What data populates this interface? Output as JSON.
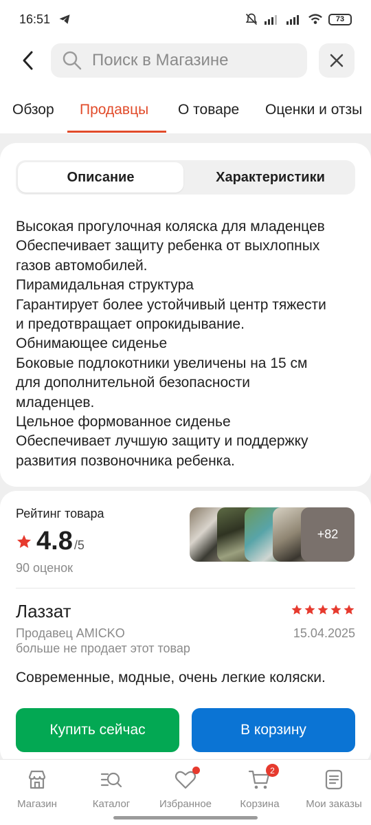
{
  "status_bar": {
    "time": "16:51",
    "battery": "73"
  },
  "search": {
    "placeholder": "Поиск в Магазине"
  },
  "tabs": [
    {
      "label": "Обзор"
    },
    {
      "label": "Продавцы"
    },
    {
      "label": "О товаре"
    },
    {
      "label": "Оценки и отзы"
    }
  ],
  "segment": {
    "description": "Описание",
    "specs": "Характеристики"
  },
  "description_lines": [
    "Высокая прогулочная коляска для младенцев",
    "Обеспечивает защиту ребенка от выхлопных",
    "газов автомобилей.",
    "Пирамидальная структура",
    "Гарантирует более устойчивый центр тяжести",
    "и предотвращает опрокидывание.",
    "Обнимающее сиденье",
    "Боковые подлокотники увеличены на 15 см",
    "для дополнительной безопасности",
    "младенцев.",
    "Цельное формованное сиденье",
    "Обеспечивает лучшую защиту и поддержку",
    "развития позвоночника ребенка."
  ],
  "rating": {
    "label": "Рейтинг товара",
    "value": "4.8",
    "max": "/5",
    "count": "90 оценок",
    "photos_more": "+82"
  },
  "review": {
    "author": "Лаззат",
    "stars": 5,
    "seller": "Продавец AMICKO",
    "date": "15.04.2025",
    "seller_note": "больше не продает этот товар",
    "text": "Современные, модные, очень легкие коляски."
  },
  "actions": {
    "buy": "Купить сейчас",
    "cart": "В корзину"
  },
  "bottom_nav": {
    "shop": "Магазин",
    "catalog": "Каталог",
    "favorites": "Избранное",
    "cart": "Корзина",
    "cart_badge": "2",
    "orders": "Мои заказы"
  },
  "colors": {
    "accent": "#e14b2a",
    "buy": "#03a853",
    "cart": "#0b74d4",
    "star": "#e63a2e"
  }
}
